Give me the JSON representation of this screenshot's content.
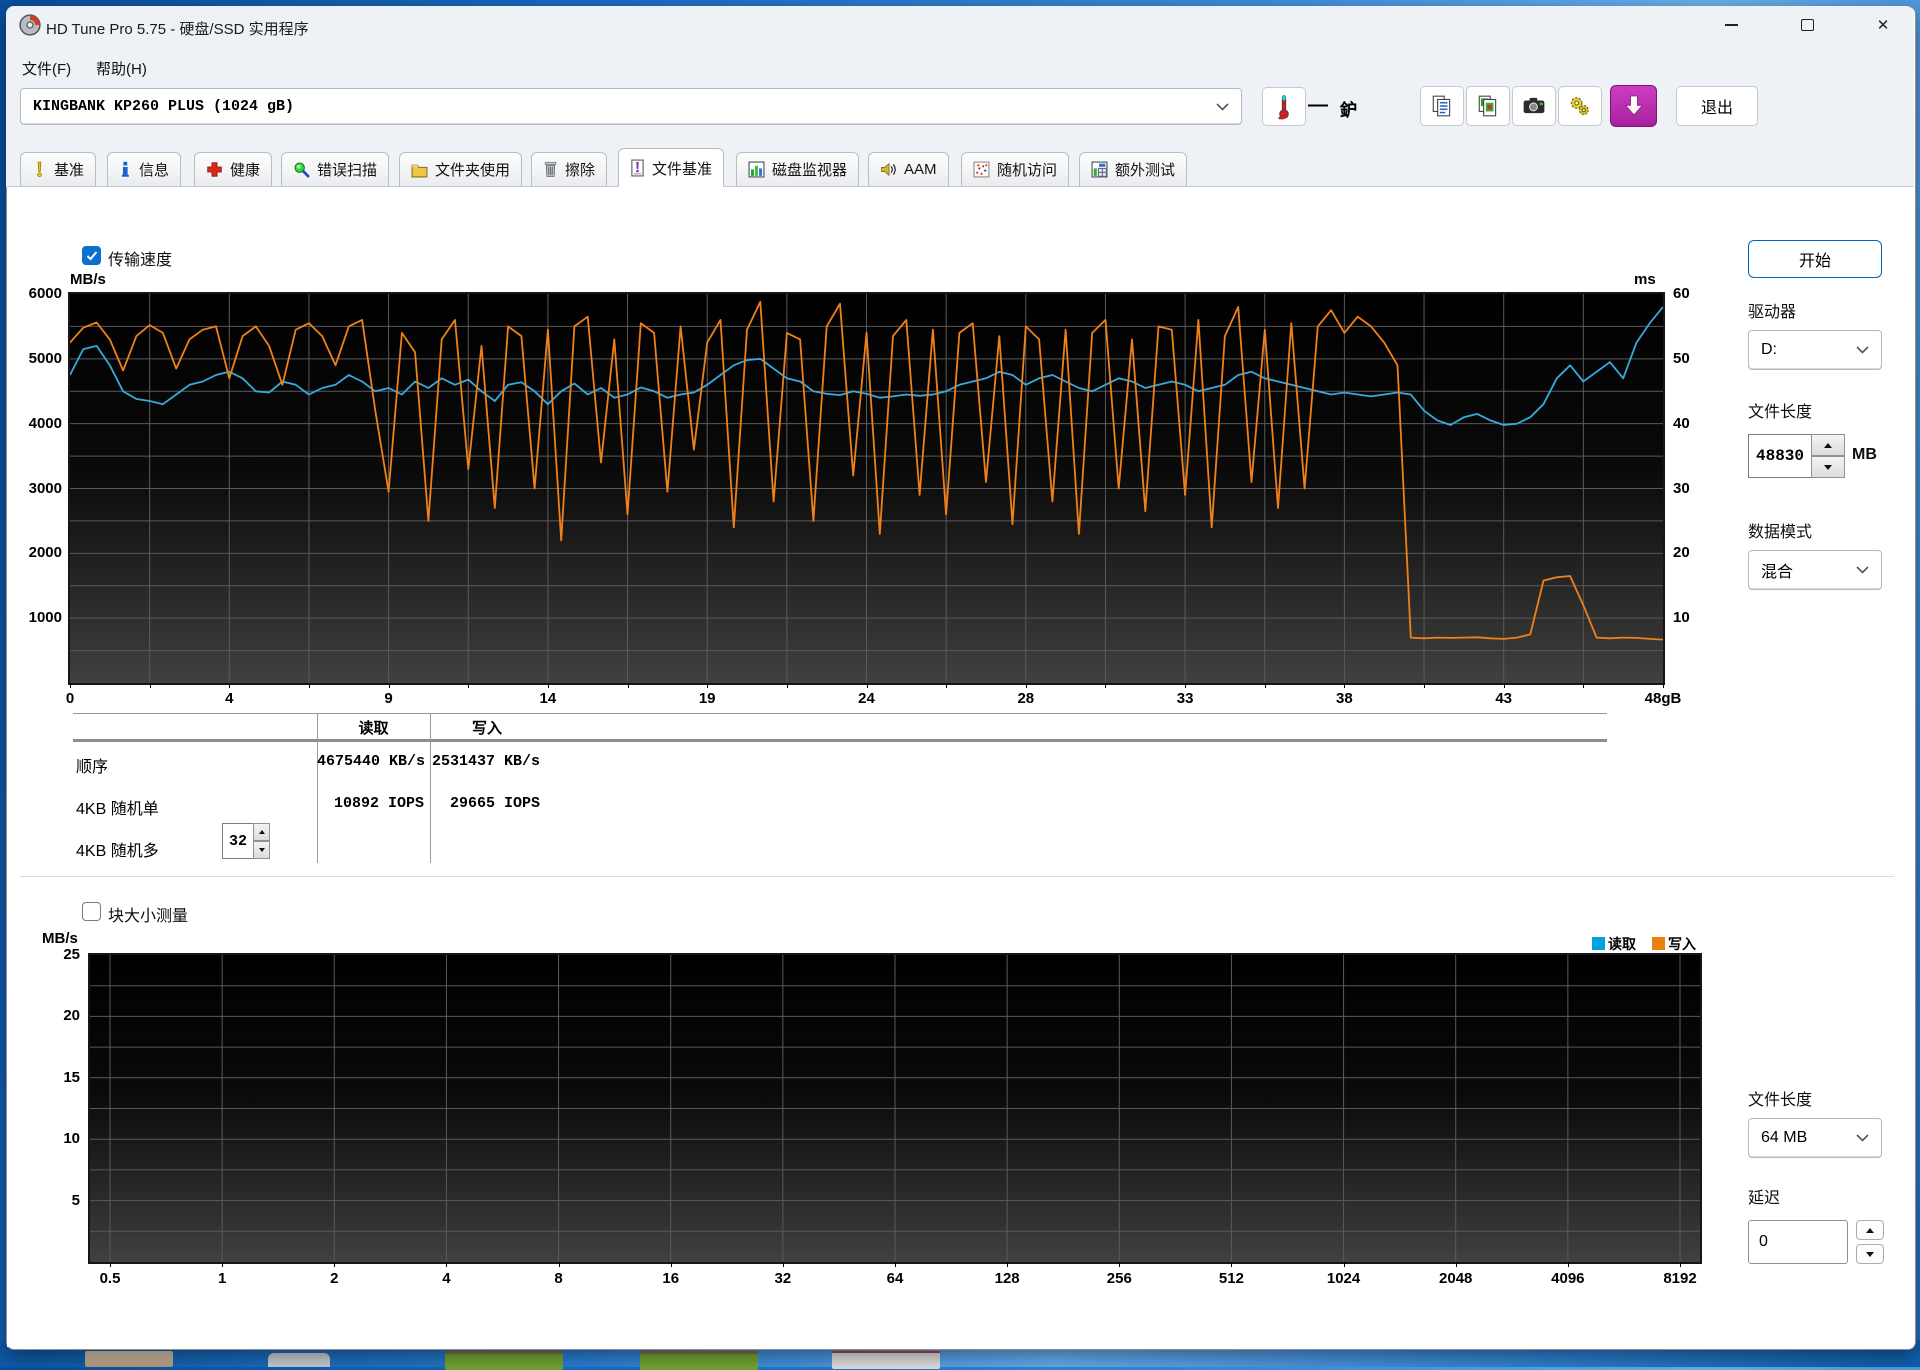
{
  "window": {
    "title": "HD Tune Pro 5.75 - 硬盘/SSD 实用程序"
  },
  "menu": {
    "items": [
      {
        "label": "文件(F)"
      },
      {
        "label": "帮助(H)"
      }
    ]
  },
  "toolbar": {
    "drive_selector": "KINGBANK KP260 PLUS (1024 gB)",
    "temperature_dash": "—",
    "temperature_unit": "鈩",
    "exit_label": "退出"
  },
  "tabs": [
    {
      "label": "基准",
      "icon": "benchmark-icon"
    },
    {
      "label": "信息",
      "icon": "info-icon"
    },
    {
      "label": "健康",
      "icon": "health-icon"
    },
    {
      "label": "错误扫描",
      "icon": "error-scan-icon"
    },
    {
      "label": "文件夹使用",
      "icon": "folder-usage-icon"
    },
    {
      "label": "擦除",
      "icon": "erase-icon"
    },
    {
      "label": "文件基准",
      "icon": "file-benchmark-icon",
      "active": true
    },
    {
      "label": "磁盘监视器",
      "icon": "disk-monitor-icon"
    },
    {
      "label": "AAM",
      "icon": "aam-icon"
    },
    {
      "label": "随机访问",
      "icon": "random-access-icon"
    },
    {
      "label": "额外测试",
      "icon": "extra-tests-icon"
    }
  ],
  "file_benchmark": {
    "transfer_speed_label": "传输速度",
    "transfer_speed_checked": true,
    "start_button": "开始",
    "drive": {
      "label": "驱动器",
      "value": "D:"
    },
    "file_length": {
      "label": "文件长度",
      "value": "48830",
      "unit": "MB"
    },
    "data_mode": {
      "label": "数据模式",
      "value": "混合"
    },
    "results": {
      "headers": {
        "read": "读取",
        "write": "写入"
      },
      "rows": [
        {
          "label": "顺序",
          "read": "4675440 KB/s",
          "write": "2531437 KB/s"
        },
        {
          "label": "4KB 随机单",
          "read": "10892 IOPS",
          "write": "29665 IOPS"
        },
        {
          "label": "4KB 随机多",
          "read": "",
          "write": "",
          "spinner_value": "32"
        }
      ]
    },
    "block_size": {
      "checkbox_label": "块大小测量",
      "checked": false,
      "legend": [
        {
          "label": "读取",
          "color": "#00a2e0"
        },
        {
          "label": "写入",
          "color": "#e8820e"
        }
      ],
      "file_length": {
        "label": "文件长度",
        "value": "64 MB"
      },
      "delay": {
        "label": "延迟",
        "value": "0"
      }
    }
  },
  "chart_data": [
    {
      "type": "line",
      "title": "传输速度",
      "ylabel_left": "MB/s",
      "ylabel_right": "ms",
      "ylim": [
        0,
        6000
      ],
      "ylim_right": [
        0,
        60
      ],
      "y_ticks_left": [
        6000,
        5000,
        4000,
        3000,
        2000,
        1000
      ],
      "y_ticks_right": [
        60,
        50,
        40,
        30,
        20,
        10
      ],
      "x_ticks": [
        "0",
        "4",
        "9",
        "14",
        "19",
        "24",
        "28",
        "33",
        "38",
        "43",
        "48gB"
      ],
      "xlim": [
        0,
        48
      ],
      "x_unit": "gB",
      "grid": {
        "x_divisions": 20,
        "y_divisions": 12
      },
      "series": [
        {
          "name": "读取",
          "color": "#38a9de",
          "x_start": 0,
          "x_step": 0.4,
          "values": [
            4750,
            5150,
            5200,
            4900,
            4500,
            4380,
            4350,
            4300,
            4450,
            4600,
            4650,
            4750,
            4800,
            4700,
            4500,
            4480,
            4650,
            4600,
            4450,
            4550,
            4600,
            4750,
            4650,
            4500,
            4550,
            4450,
            4650,
            4550,
            4700,
            4600,
            4680,
            4500,
            4350,
            4600,
            4640,
            4500,
            4300,
            4500,
            4620,
            4450,
            4550,
            4400,
            4450,
            4560,
            4500,
            4400,
            4450,
            4480,
            4600,
            4750,
            4900,
            4980,
            5000,
            4850,
            4700,
            4650,
            4500,
            4460,
            4440,
            4500,
            4460,
            4400,
            4420,
            4450,
            4430,
            4450,
            4500,
            4600,
            4650,
            4700,
            4800,
            4750,
            4600,
            4700,
            4750,
            4650,
            4550,
            4500,
            4600,
            4700,
            4650,
            4550,
            4600,
            4650,
            4600,
            4500,
            4550,
            4600,
            4750,
            4800,
            4700,
            4650,
            4600,
            4550,
            4500,
            4450,
            4480,
            4450,
            4420,
            4450,
            4480,
            4450,
            4200,
            4050,
            3980,
            4100,
            4150,
            4050,
            3980,
            4000,
            4100,
            4300,
            4700,
            4900,
            4650,
            4800,
            4950,
            4700,
            5250,
            5550,
            5800
          ]
        },
        {
          "name": "写入",
          "color": "#f08018",
          "x_start": 0,
          "x_step": 0.4,
          "values": [
            5250,
            5480,
            5560,
            5300,
            4820,
            5350,
            5520,
            5400,
            4850,
            5300,
            5450,
            5500,
            4700,
            5350,
            5500,
            5200,
            4600,
            5450,
            5550,
            5350,
            4900,
            5500,
            5600,
            4200,
            2950,
            5400,
            5100,
            2500,
            5300,
            5600,
            3300,
            5200,
            2700,
            5500,
            5350,
            3000,
            5450,
            2200,
            5500,
            5650,
            3400,
            5300,
            2600,
            5550,
            5400,
            2950,
            5500,
            3600,
            5250,
            5600,
            2400,
            5450,
            5880,
            2800,
            5400,
            5300,
            2500,
            5500,
            5850,
            3200,
            5400,
            2300,
            5350,
            5600,
            2900,
            5450,
            2600,
            5400,
            5550,
            3100,
            5350,
            2450,
            5500,
            5300,
            2800,
            5450,
            2300,
            5400,
            5600,
            3000,
            5300,
            2650,
            5500,
            5450,
            2900,
            5600,
            2400,
            5350,
            5800,
            3100,
            5450,
            2700,
            5550,
            3000,
            5500,
            5750,
            5400,
            5650,
            5500,
            5250,
            4900,
            700,
            690,
            700,
            695,
            700,
            705,
            690,
            680,
            700,
            750,
            1580,
            1630,
            1650,
            1200,
            700,
            690,
            700,
            695,
            680,
            670
          ]
        }
      ]
    },
    {
      "type": "line",
      "title": "块大小测量",
      "ylabel": "MB/s",
      "ylim": [
        0,
        25
      ],
      "y_ticks": [
        25,
        20,
        15,
        10,
        5
      ],
      "x_ticks": [
        "0.5",
        "1",
        "2",
        "4",
        "8",
        "16",
        "32",
        "64",
        "128",
        "256",
        "512",
        "1024",
        "2048",
        "4096",
        "8192"
      ],
      "x_scale": "log2",
      "legend": [
        "读取",
        "写入"
      ],
      "series": []
    }
  ]
}
